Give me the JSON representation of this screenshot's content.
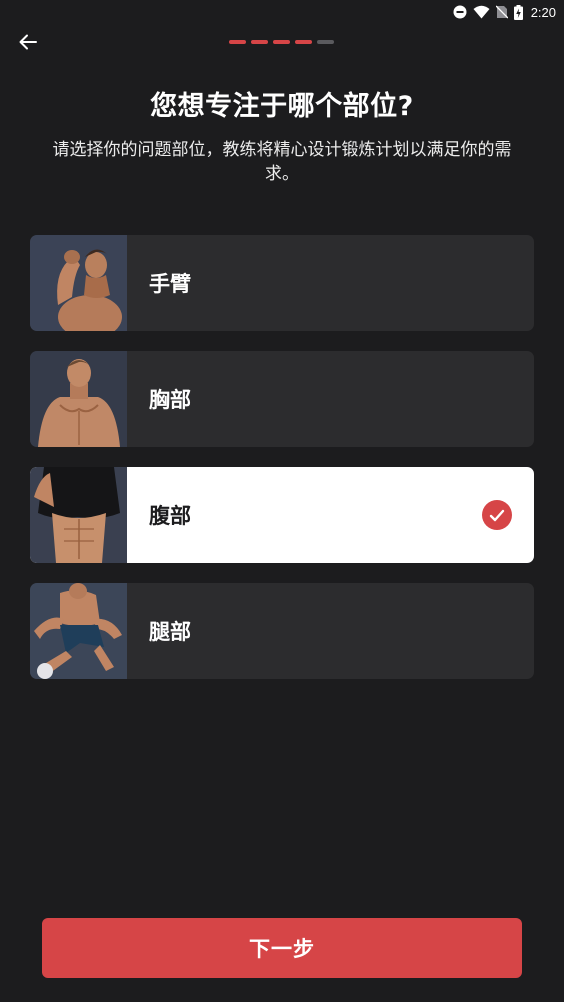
{
  "status_bar": {
    "time": "2:20",
    "icons": [
      "do-not-disturb-icon",
      "wifi-icon",
      "no-sim-icon",
      "battery-charging-icon"
    ]
  },
  "nav": {
    "back_icon": "back-arrow-icon",
    "progress": {
      "total_steps": 5,
      "completed_steps": 4,
      "active_color": "#d64547",
      "inactive_color": "#5a5a5e"
    }
  },
  "header": {
    "title": "您想专注于哪个部位?",
    "subtitle": "请选择你的问题部位，教练将精心设计锻炼计划以满足你的需求。"
  },
  "options": [
    {
      "label": "手臂",
      "image": "arms-flex-photo",
      "selected": false
    },
    {
      "label": "胸部",
      "image": "chest-photo",
      "selected": false
    },
    {
      "label": "腹部",
      "image": "abs-photo",
      "selected": true
    },
    {
      "label": "腿部",
      "image": "legs-jump-photo",
      "selected": false
    }
  ],
  "selection_check_icon": "checkmark-circle-icon",
  "footer": {
    "next_label": "下一步"
  },
  "colors": {
    "background": "#1c1c1e",
    "card": "#2c2c2e",
    "card_selected": "#ffffff",
    "accent": "#d64547"
  }
}
